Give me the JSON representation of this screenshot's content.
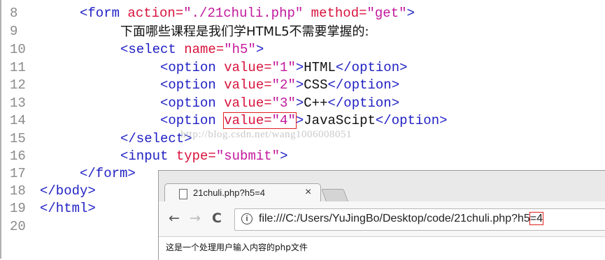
{
  "editor": {
    "lines": [
      {
        "num": "8",
        "t1": "<form ",
        "a1": "action=",
        "v1": "\"./21chuli.php\"",
        "a2": " method=",
        "v2": "\"get\"",
        "t2": ">"
      },
      {
        "num": "9",
        "text": "下面哪些课程是我们学HTML5不需要掌握的:"
      },
      {
        "num": "10",
        "t1": "<select ",
        "a1": "name=",
        "v1": "\"h5\"",
        "t2": ">"
      },
      {
        "num": "11",
        "t1": "<option ",
        "a1": "value=",
        "v1": "\"1\"",
        "t2": ">",
        "text": "HTML",
        "t3": "</option>"
      },
      {
        "num": "12",
        "t1": "<option ",
        "a1": "value=",
        "v1": "\"2\"",
        "t2": ">",
        "text": "CSS",
        "t3": "</option>"
      },
      {
        "num": "13",
        "t1": "<option ",
        "a1": "value=",
        "v1": "\"3\"",
        "t2": ">",
        "text": "C++",
        "t3": "</option>"
      },
      {
        "num": "14",
        "t1": "<option ",
        "a1": "value=",
        "v1": "\"4\"",
        "t2": ">",
        "text": "JavaScipt",
        "t3": "</option>"
      },
      {
        "num": "15",
        "t1": "</select>"
      },
      {
        "num": "16",
        "t1": "<input ",
        "a1": "type=",
        "v1": "\"submit\"",
        "t2": ">"
      },
      {
        "num": "17",
        "t1": "</form>"
      },
      {
        "num": "18",
        "t1": "</body>"
      },
      {
        "num": "19",
        "t1": "</html>"
      },
      {
        "num": "20"
      }
    ],
    "watermark": "http://blog.csdn.net/wang1006008051"
  },
  "browser": {
    "tab_title": "21chuli.php?h5=4",
    "tab_close": "×",
    "nav_back": "←",
    "nav_forward": "→",
    "nav_reload": "C",
    "info_glyph": "i",
    "url_prefix": "file:///C:/Users/YuJingBo/Desktop/code/21chuli.php?h5",
    "url_suffix": "=4",
    "page_text": "这是一个处理用户输入内容的php文件"
  },
  "colors": {
    "tag": "#1f1fc4",
    "attr": "#d8123c",
    "value": "#c2189c",
    "highlight": "#e0201e"
  }
}
